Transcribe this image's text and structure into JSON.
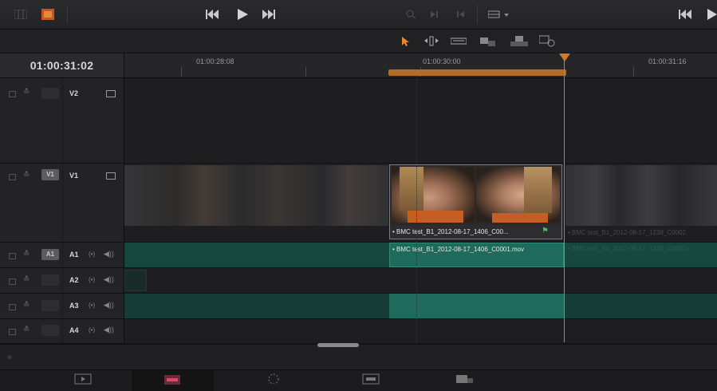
{
  "timecode": "01:00:31:02",
  "ruler": {
    "labels": [
      "01:00:28:08",
      "01:00:30:00",
      "01:00:31:16"
    ]
  },
  "tracks": {
    "v2": {
      "name": "V2"
    },
    "v1": {
      "name": "V1",
      "source": "V1"
    },
    "a1": {
      "name": "A1",
      "source": "A1"
    },
    "a2": {
      "name": "A2"
    },
    "a3": {
      "name": "A3"
    },
    "a4": {
      "name": "A4"
    }
  },
  "audio_monitor_glyph": "(•)",
  "speaker_glyph": "◀))",
  "clips": {
    "video_selected_label": "• BMC test_B1_2012-08-17_1406_C00...",
    "video_next_label": "• BMC test_B1_2012-08-17_1238_C0002.",
    "audio_selected_label": "• BMC test_B1_2012-08-17_1406_C0001.mov",
    "audio_next_label": "• BMC test_B1_2012-08-17_1238_C0002.r"
  },
  "colors": {
    "playhead": "#d07a2a",
    "audio_clip": "#16483d",
    "audio_clip_selected": "#1f6b5b"
  },
  "collapse_glyph": "«",
  "icons": [
    "grid-view-icon",
    "filmstrip-icon",
    "skip-back-icon",
    "play-icon",
    "skip-forward-icon",
    "zoom-icon",
    "selection-tool-icon",
    "trim-tool-icon",
    "blade-tool-icon",
    "insert-icon",
    "overwrite-icon",
    "replace-icon",
    "media-page-icon",
    "edit-page-icon",
    "color-page-icon",
    "fairlight-page-icon",
    "deliver-page-icon"
  ]
}
